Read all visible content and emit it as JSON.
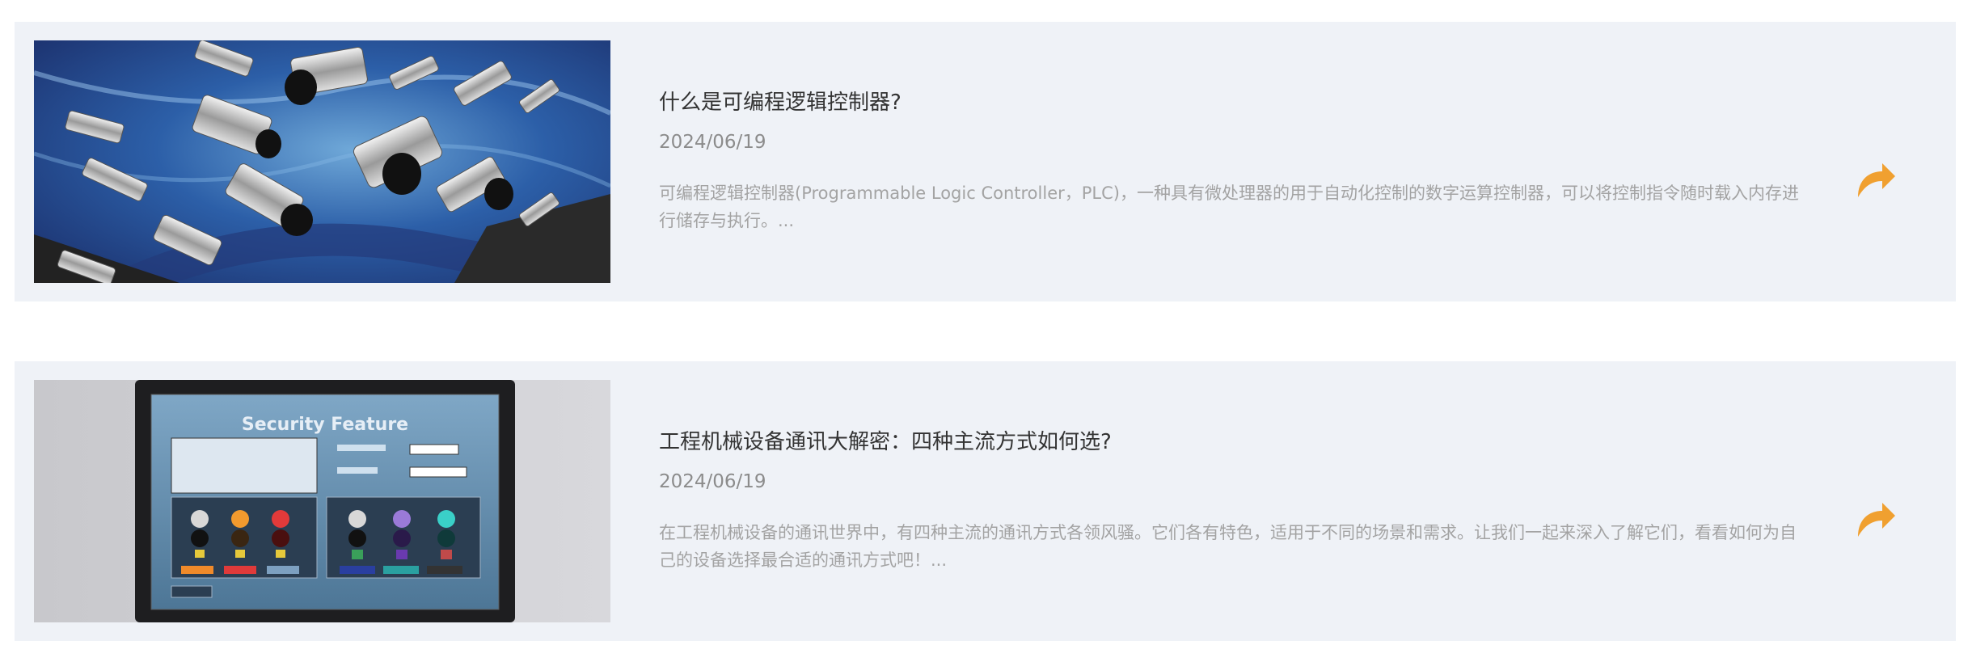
{
  "articles": [
    {
      "title": "什么是可编程逻辑控制器?",
      "date": "2024/06/19",
      "excerpt": "可编程逻辑控制器(Programmable Logic Controller，PLC)，一种具有微处理器的用于自动化控制的数字运算控制器，可以将控制指令随时载入内存进行储存与执行。...",
      "image": "proximity-sensors-photo",
      "action_icon": "share-arrow-icon"
    },
    {
      "title": "工程机械设备通讯大解密：四种主流方式如何选?",
      "date": "2024/06/19",
      "excerpt": "在工程机械设备的通讯世界中，有四种主流的通讯方式各领风骚。它们各有特色，适用于不同的场景和需求。让我们一起来深入了解它们，看看如何为自己的设备选择最合适的通讯方式吧！...",
      "image": "hmi-touch-panel-photo",
      "image_text": "Security Feature",
      "action_icon": "share-arrow-icon"
    }
  ],
  "colors": {
    "card_bg": "#eff2f7",
    "title": "#333333",
    "date": "#8c8c8c",
    "excerpt": "#a3a3a3",
    "accent": "#f0a030"
  }
}
